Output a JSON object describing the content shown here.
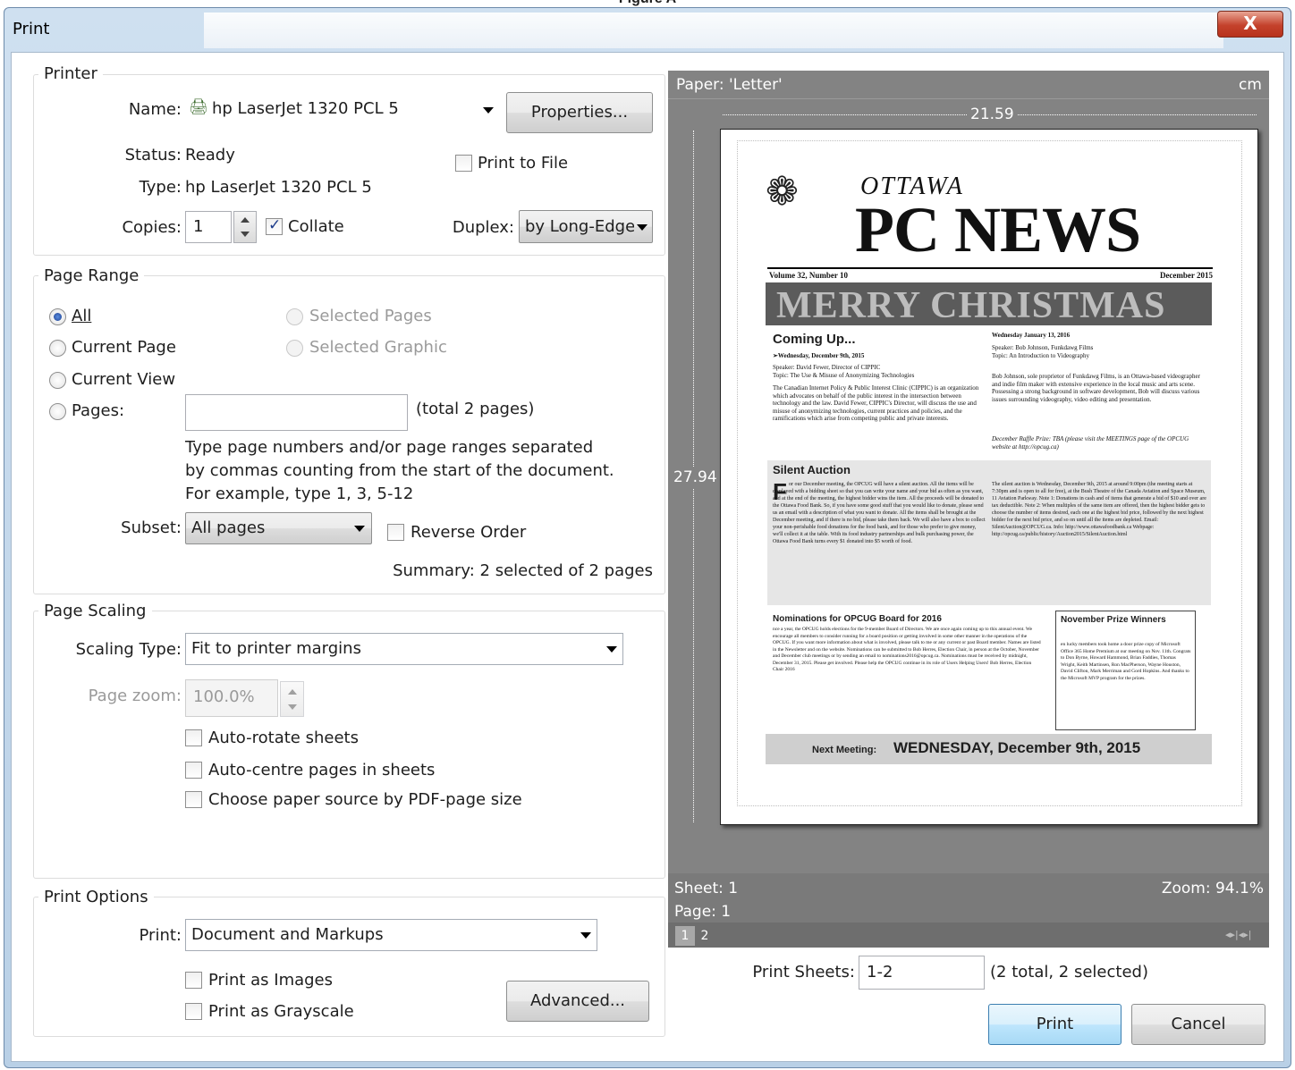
{
  "figure_caption": "Figure A",
  "window": {
    "title": "Print",
    "close_label": "X"
  },
  "printer": {
    "legend": "Printer",
    "name_label": "Name:",
    "name_value": "hp LaserJet 1320 PCL 5",
    "properties_label": "Properties...",
    "status_label": "Status:",
    "status_value": "Ready",
    "print_to_file_label": "Print to File",
    "type_label": "Type:",
    "type_value": "hp LaserJet 1320 PCL 5",
    "copies_label": "Copies:",
    "copies_value": "1",
    "collate_label": "Collate",
    "collate_checked": true,
    "duplex_label": "Duplex:",
    "duplex_value": "by Long-Edge"
  },
  "page_range": {
    "legend": "Page Range",
    "all_label": "All",
    "current_page_label": "Current Page",
    "current_view_label": "Current View",
    "pages_label": "Pages:",
    "selected_pages_label": "Selected Pages",
    "selected_graphic_label": "Selected Graphic",
    "pages_value": "",
    "total_pages": "(total 2 pages)",
    "help_text": "Type page numbers and/or page ranges separated by commas counting from the start of the document. For example, type 1, 3, 5-12",
    "subset_label": "Subset:",
    "subset_value": "All pages",
    "reverse_order_label": "Reverse Order",
    "summary": "Summary: 2 selected of 2 pages"
  },
  "page_scaling": {
    "legend": "Page Scaling",
    "scaling_type_label": "Scaling Type:",
    "scaling_type_value": "Fit to printer margins",
    "page_zoom_label": "Page zoom:",
    "page_zoom_value": "100.0%",
    "auto_rotate_label": "Auto-rotate sheets",
    "auto_centre_label": "Auto-centre pages in sheets",
    "paper_source_label": "Choose paper source by PDF-page size"
  },
  "print_options": {
    "legend": "Print Options",
    "print_label": "Print:",
    "print_value": "Document and Markups",
    "as_images_label": "Print as Images",
    "as_grayscale_label": "Print as Grayscale",
    "advanced_label": "Advanced..."
  },
  "preview": {
    "paper_label": "Paper: 'Letter'",
    "units": "cm",
    "width_value": "21.59",
    "height_value": "27.94",
    "sheet_label": "Sheet: 1",
    "page_label": "Page: 1",
    "zoom_label": "Zoom: 94.1%",
    "page_tabs": [
      "1",
      "2"
    ],
    "nav_glyphs": "◂▸|◂▸|"
  },
  "newsletter": {
    "masthead_small": "OTTAWA",
    "masthead_big": "PC NEWS",
    "volume": "Volume 32, Number 10",
    "date": "December 2015",
    "banner": "MERRY CHRISTMAS",
    "coming_up": "Coming Up...",
    "coming_date": "➢Wednesday, December 9th, 2015",
    "speaker_1": "Speaker: David Fewer, Director of CIPPIC",
    "topic_1": "Topic: The Use & Misuse of Anonymizing Technologies",
    "body_1": "The Canadian Internet Policy & Public Interest Clinic (CIPPIC) is an organization which advocates on behalf of the public interest in the intersection between technology and the law. David Fewer, CIPPIC's Director, will discuss the use and misuse of anonymizing technologies, current practices and policies, and the ramifications which arise from competing public and private interests.",
    "right_date": "Wednesday January 13, 2016",
    "speaker_2": "Speaker: Bob Johnson, Funkdawg Films",
    "topic_2": "Topic: An Introduction to Videography",
    "body_2": "Bob Johnson, sole proprietor of Funkdawg Films, is an Ottawa-based videographer and indie film maker with extensive experience in the local music and arts scene. Possessing a strong background in software development, Bob will discuss various issues surrounding videography, video editing and presentation.",
    "raffle": "December Raffle Prize: TBA (please visit the MEETINGS page of the OPCUG website at http://opcug.ca)",
    "silent_title": "Silent Auction",
    "silent_body_left": "or our December meeting, the OPCUG will have a silent auction. All the items will be displayed with a bidding sheet so that you can write your name and your bid as often as you want, and at the end of the meeting, the highest bidder wins the item. All the proceeds will be donated to the Ottawa Food Bank. So, if you have some good stuff that you would like to donate, please send us an email with a description of what you want to donate. All the items shall be brought at the December meeting, and if there is no bid, please take them back. We will also have a box to collect your non-perishable food donations for the food bank, and for those who prefer to give money, we'll collect it at the table. With its food industry partnerships and bulk purchasing power, the Ottawa Food Bank turns every $1 donated into $5 worth of food.",
    "silent_body_right": "The silent auction is Wednesday, December 9th, 2015 at around 9:00pm (the meeting starts at 7:30pm and is open to all for free), at the Bush Theatre of the Canada Aviation and Space Museum, 11 Aviation Parkway. Note 1: Donations in cash and of items that generate a bid of $10 and over are tax deductible. Note 2: When multiples of the same item are offered, then the highest bidder gets to choose the number of items desired, each one at the highest bid price, followed by the next highest bidder for the next bid price, and so on until all the items are depleted. Email: SilentAuction@OPCUG.ca. Info: http://www.ottawafoodbank.ca Webpage: http://opcug.ca/public/history/Auction2015/SilentAuction.html",
    "nominations_title": "Nominations for OPCUG Board for 2016",
    "nominations_body": "nce a year, the OPCUG holds elections for the 9-member Board of Directors. We are once again coming up to this annual event. We encourage all members to consider running for a board position or getting involved in some other manner in the operations of the OPCUG. If you want more information about what is involved, please talk to me or any current or past Board member. Names are listed in the Newsletter and on the website. Nominations can be submitted to Bob Herres, Election Chair, in person at the October, November and December club meetings or by sending an email to nominations2016@opcug.ca. Nominations must be received by midnight, December 31, 2015. Please get involved. Please help the OPCUG continue in its role of Users Helping Users! Bob Herres, Election Chair 2016",
    "prize_title": "November Prize Winners",
    "prize_body": "en lucky members took home a door prize copy of Microsoft Office 365 Home Premium at our meeting on Nov. 11th. Congrats to Don Byrne, Howard Hammond, Brian Faddies, Thomas Wright, Keith Martinsen, Ron MacPherson, Wayne Houston, David Clifton, Mark Merriman and Gord Hopkins. And thanks to the Microsoft MVP program for the prizes.",
    "next_meeting_label": "Next Meeting:",
    "next_meeting_value": "WEDNESDAY, December 9th, 2015"
  },
  "footer": {
    "print_sheets_label": "Print Sheets:",
    "print_sheets_value": "1-2",
    "sheets_summary": "(2 total, 2 selected)",
    "print_button": "Print",
    "cancel_button": "Cancel"
  }
}
